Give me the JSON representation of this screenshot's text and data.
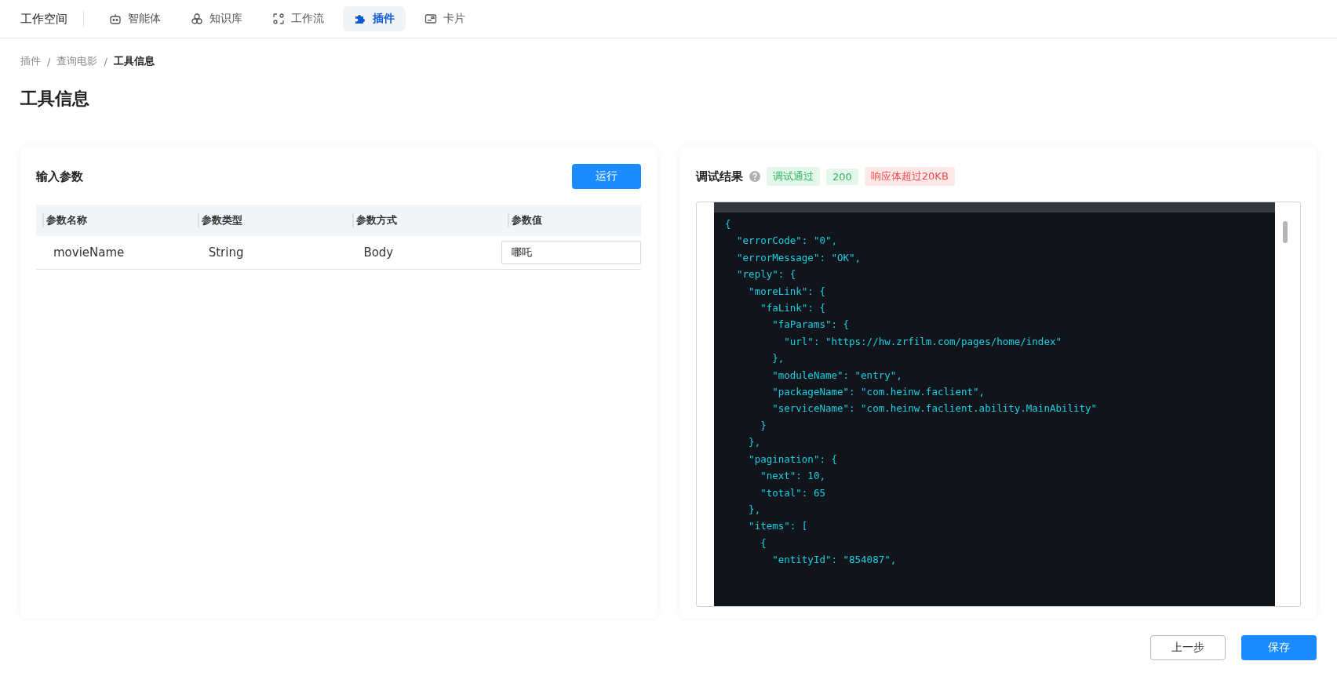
{
  "nav": {
    "title": "工作空间",
    "tabs": [
      {
        "label": "智能体",
        "selected": false
      },
      {
        "label": "知识库",
        "selected": false
      },
      {
        "label": "工作流",
        "selected": false
      },
      {
        "label": "插件",
        "selected": true
      },
      {
        "label": "卡片",
        "selected": false
      }
    ]
  },
  "breadcrumb": [
    "插件",
    "查询电影",
    "工具信息"
  ],
  "breadcrumb_separators": [
    "/",
    "/"
  ],
  "page_title": "工具信息",
  "input_panel": {
    "title": "输入参数",
    "run_button": "运行",
    "columns": [
      "参数名称",
      "参数类型",
      "参数方式",
      "参数值"
    ],
    "rows": [
      {
        "name": "movieName",
        "type": "String",
        "method": "Body",
        "value": "哪吒"
      }
    ]
  },
  "result_panel": {
    "title": "调试结果",
    "tags": [
      {
        "label": "调试通过",
        "color": "#2db55d"
      },
      {
        "label": "200",
        "color": "#2db55d"
      },
      {
        "label": "响应体超过20KB",
        "color": "#f5484b"
      }
    ],
    "code_lines": [
      "{",
      "  \"errorCode\": \"0\",",
      "  \"errorMessage\": \"OK\",",
      "  \"reply\": {",
      "    \"moreLink\": {",
      "      \"faLink\": {",
      "        \"faParams\": {",
      "          \"url\": \"https://hw.zrfilm.com/pages/home/index\"",
      "        },",
      "        \"moduleName\": \"entry\",",
      "        \"packageName\": \"com.heinw.faclient\",",
      "        \"serviceName\": \"com.heinw.faclient.ability.MainAbility\"",
      "      }",
      "    },",
      "    \"pagination\": {",
      "      \"next\": 10,",
      "      \"total\": 65",
      "    },",
      "    \"items\": [",
      "      {",
      "        \"entityId\": \"854087\","
    ]
  },
  "footer": {
    "buttons": [
      {
        "label": "上一步",
        "kind": "secondary"
      },
      {
        "label": "保存",
        "kind": "primary"
      }
    ]
  }
}
